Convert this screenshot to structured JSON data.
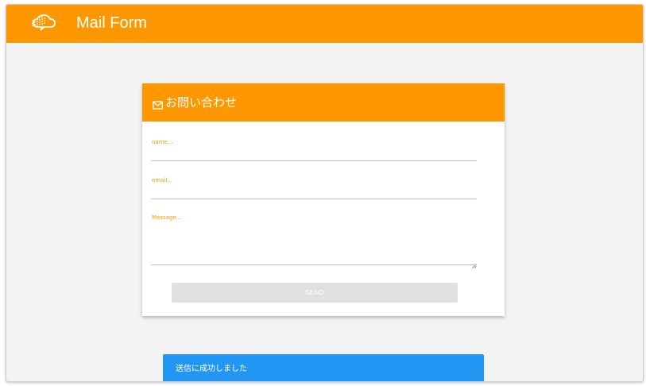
{
  "app": {
    "title": "Mail Form",
    "logo_icon": "cloud-dots-logo",
    "accent_color": "#ff9800"
  },
  "form": {
    "header_icon": "mail-icon",
    "title": "お問い合わせ",
    "name_placeholder": "name...",
    "email_placeholder": "email...",
    "message_placeholder": "Message...",
    "send_label": "SEND"
  },
  "snackbar": {
    "text": "送信に成功しました",
    "color": "#2196f3"
  }
}
